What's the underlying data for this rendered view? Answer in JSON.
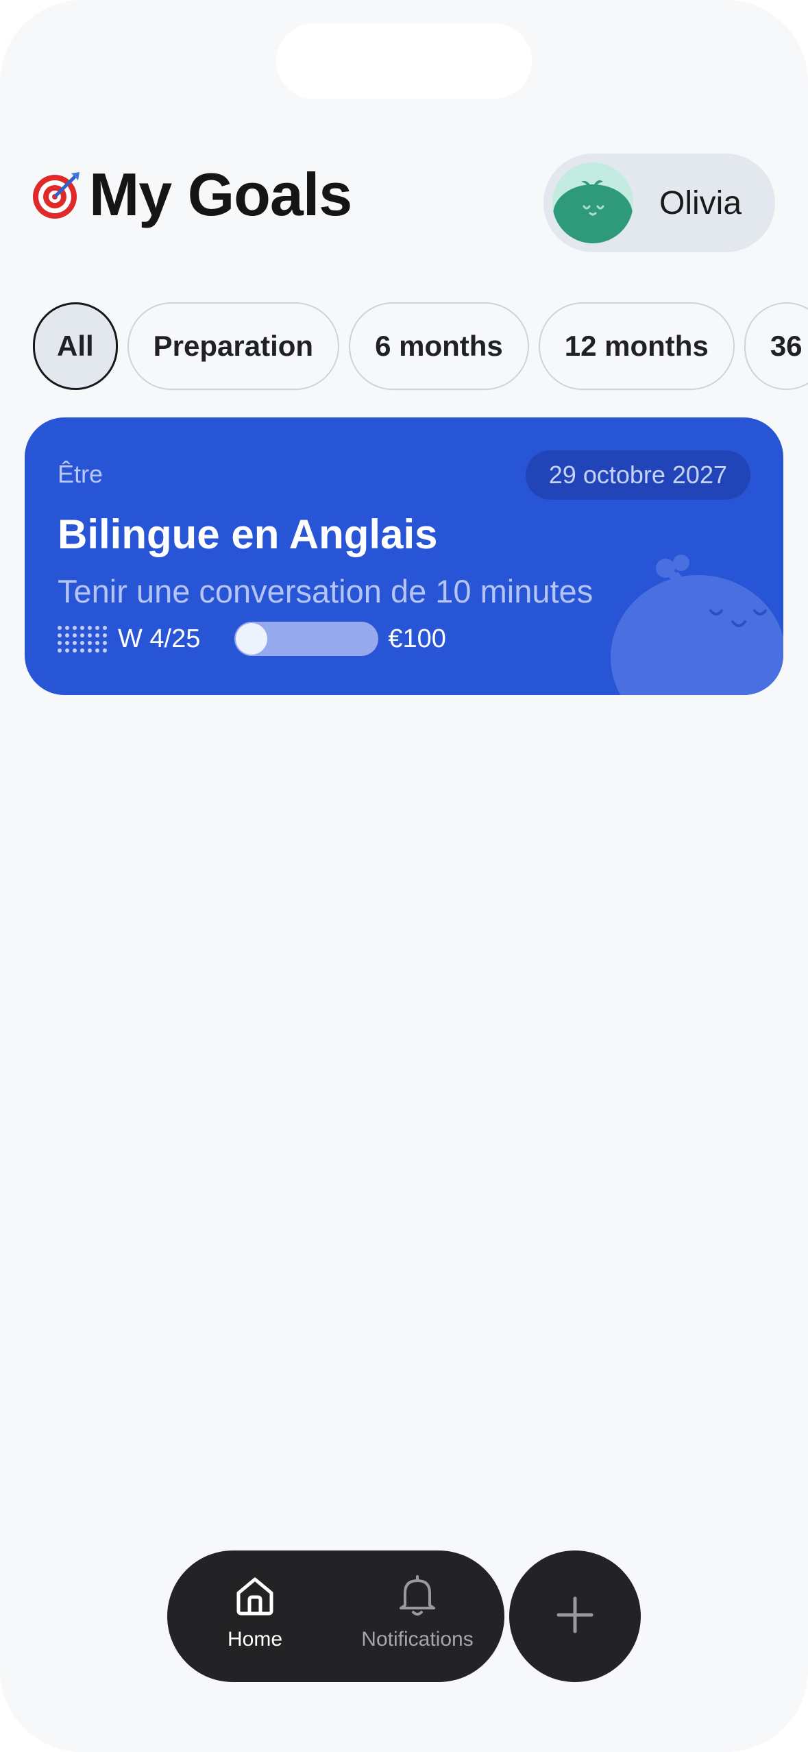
{
  "header": {
    "title": "My Goals",
    "icon": "target-icon"
  },
  "profile": {
    "name": "Olivia",
    "avatar_icon": "green-blob-avatar"
  },
  "filters": [
    {
      "label": "All",
      "selected": true
    },
    {
      "label": "Preparation",
      "selected": false
    },
    {
      "label": "6 months",
      "selected": false
    },
    {
      "label": "12 months",
      "selected": false
    },
    {
      "label": "36",
      "selected": false
    }
  ],
  "goal_card": {
    "category": "Être",
    "date": "29 octobre 2027",
    "title": "Bilingue en Anglais",
    "subtitle": "Tenir une conversation de 10 minutes",
    "week": "W 4/25",
    "amount": "€100",
    "accent_color": "#2854d6"
  },
  "nav": {
    "home_label": "Home",
    "notifications_label": "Notifications",
    "add_icon": "plus-icon"
  }
}
